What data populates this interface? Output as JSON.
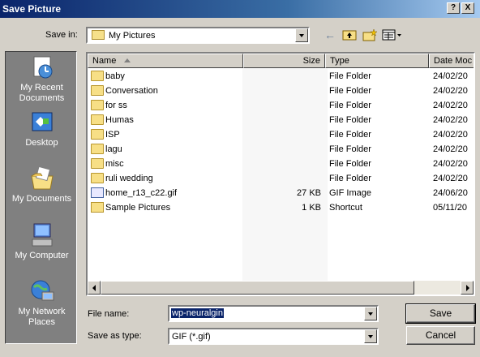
{
  "window": {
    "title": "Save Picture",
    "help_label": "?",
    "close_label": "X"
  },
  "savein": {
    "label": "Save in:",
    "value": "My Pictures"
  },
  "toolbar": {
    "back_icon": "back-arrow-icon",
    "up_icon": "up-folder-icon",
    "newfolder_icon": "new-folder-icon",
    "views_icon": "views-menu-icon"
  },
  "places": [
    {
      "label": "My Recent\nDocuments",
      "icon": "recent-documents-icon"
    },
    {
      "label": "Desktop",
      "icon": "desktop-icon"
    },
    {
      "label": "My Documents",
      "icon": "my-documents-icon"
    },
    {
      "label": "My Computer",
      "icon": "my-computer-icon"
    },
    {
      "label": "My Network\nPlaces",
      "icon": "network-places-icon"
    }
  ],
  "columns": {
    "name": "Name",
    "size": "Size",
    "type": "Type",
    "date": "Date Moc"
  },
  "files": [
    {
      "name": "baby",
      "size": "",
      "type": "File Folder",
      "date": "24/02/20",
      "kind": "folder"
    },
    {
      "name": "Conversation",
      "size": "",
      "type": "File Folder",
      "date": "24/02/20",
      "kind": "folder"
    },
    {
      "name": "for ss",
      "size": "",
      "type": "File Folder",
      "date": "24/02/20",
      "kind": "folder"
    },
    {
      "name": "Humas",
      "size": "",
      "type": "File Folder",
      "date": "24/02/20",
      "kind": "folder"
    },
    {
      "name": "ISP",
      "size": "",
      "type": "File Folder",
      "date": "24/02/20",
      "kind": "folder"
    },
    {
      "name": "lagu",
      "size": "",
      "type": "File Folder",
      "date": "24/02/20",
      "kind": "folder"
    },
    {
      "name": "misc",
      "size": "",
      "type": "File Folder",
      "date": "24/02/20",
      "kind": "folder"
    },
    {
      "name": "ruli wedding",
      "size": "",
      "type": "File Folder",
      "date": "24/02/20",
      "kind": "folder"
    },
    {
      "name": "home_r13_c22.gif",
      "size": "27 KB",
      "type": "GIF Image",
      "date": "24/06/20",
      "kind": "gif"
    },
    {
      "name": "Sample Pictures",
      "size": "1 KB",
      "type": "Shortcut",
      "date": "05/11/20",
      "kind": "shortcut"
    }
  ],
  "filename": {
    "label": "File name:",
    "value": "wp-neuralgin"
  },
  "filetype": {
    "label": "Save as type:",
    "value": "GIF (*.gif)"
  },
  "buttons": {
    "save": "Save",
    "cancel": "Cancel"
  }
}
